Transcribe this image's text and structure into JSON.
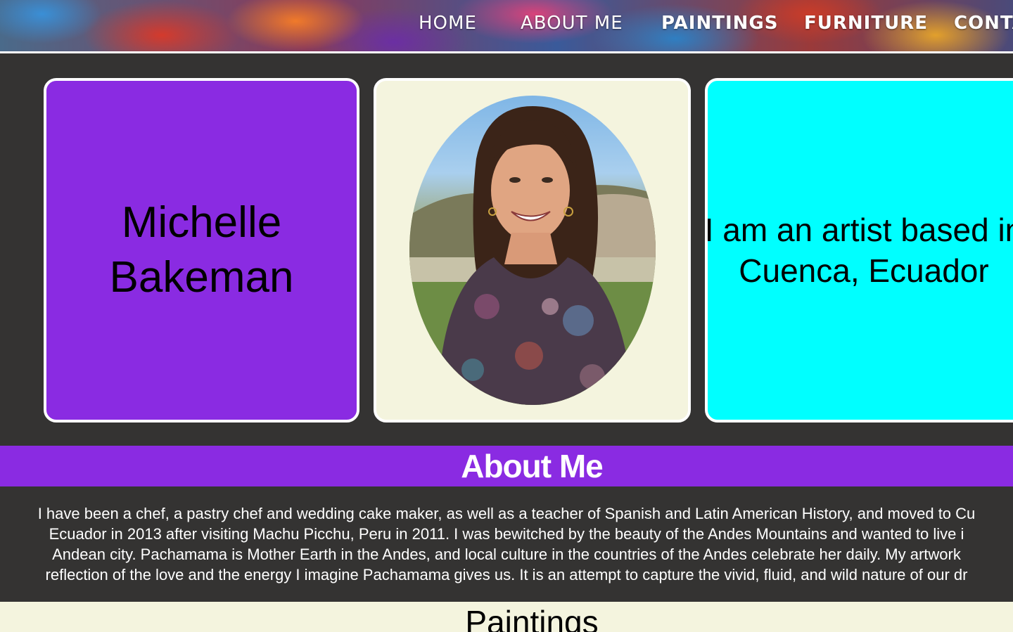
{
  "nav": {
    "items": [
      "HOME",
      "ABOUT ME",
      "PAINTINGS",
      "FURNITURE",
      "CONTACT"
    ]
  },
  "hero": {
    "name": "Michelle Bakeman",
    "photo_alt": "portrait of Michelle Bakeman",
    "tagline": "I am an artist based in Cuenca, Ecuador"
  },
  "about": {
    "title": "About Me",
    "lines": [
      "I have been a chef, a pastry chef and wedding cake maker, as well as a teacher of Spanish and Latin American History, and moved to Cu",
      "Ecuador in 2013 after visiting Machu Picchu, Peru in 2011. I was bewitched by the beauty of the Andes Mountains and wanted to live i",
      "Andean city. Pachamama is Mother Earth in the Andes, and local culture in the countries of the Andes celebrate her daily. My artwork",
      "reflection of the love and the energy I imagine Pachamama gives us. It is an attempt to capture the vivid, fluid, and wild nature of our dr"
    ]
  },
  "paintings": {
    "title": "Paintings"
  },
  "colors": {
    "background": "#343332",
    "purple": "#8a2be2",
    "cream": "#f4f4de",
    "cyan": "#00ffff"
  }
}
